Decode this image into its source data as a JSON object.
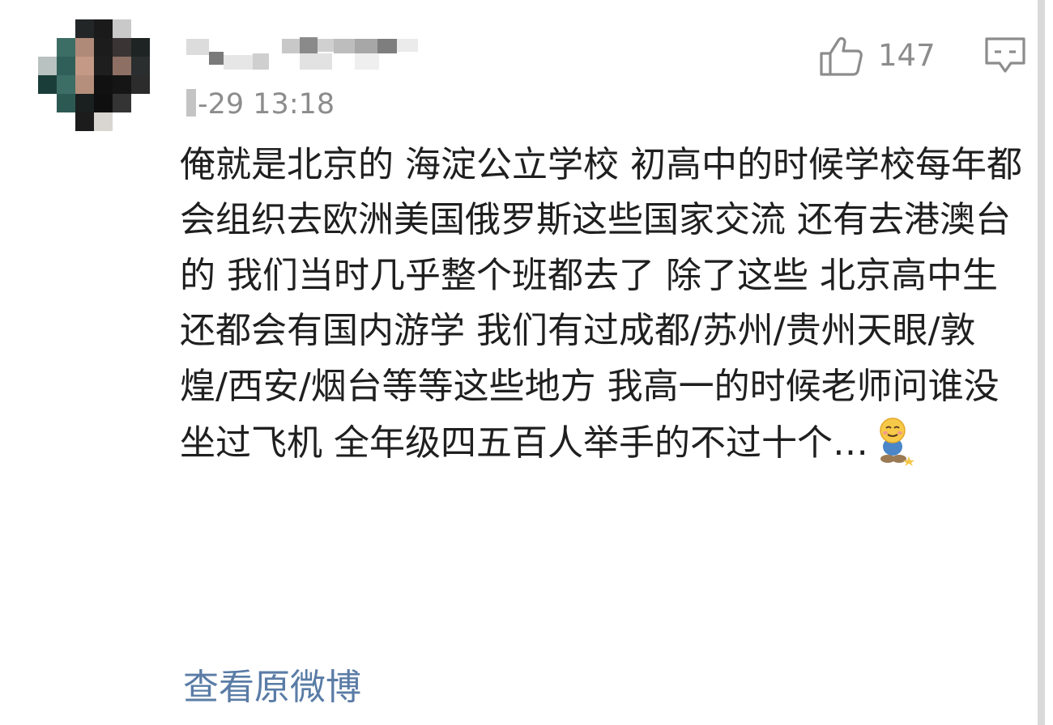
{
  "comment": {
    "timestamp": "-29 13:18",
    "likes": "147",
    "body": "俺就是北京的 海淀公立学校 初高中的时候学校每年都会组织去欧洲美国俄罗斯这些国家交流 还有去港澳台的 我们当时几乎整个班都去了 除了这些 北京高中生还都会有国内游学 我们有过成都/苏州/贵州天眼/敦煌/西安/烟台等等这些地方 我高一的时候老师问谁没坐过飞机 全年级四五百人举手的不过十个…",
    "emoji": "sheepish-smile-emoji",
    "view_original_label": "查看原微博"
  },
  "icons": {
    "like": "thumbs-up-icon",
    "comment": "comment-bubble-icon"
  },
  "colors": {
    "text": "#1f1f1f",
    "meta": "#8c8c8c",
    "link": "#5a7ca6",
    "icon": "#8c8c8c"
  }
}
